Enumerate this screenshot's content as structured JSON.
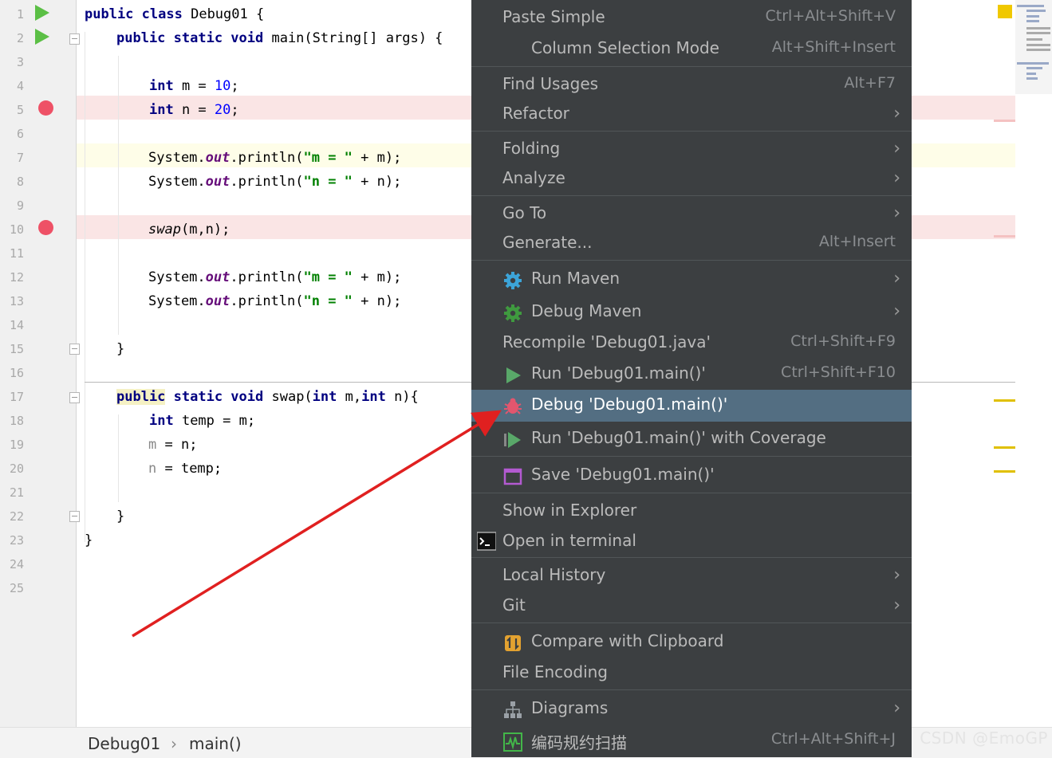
{
  "editor": {
    "line_numbers": [
      "1",
      "2",
      "3",
      "4",
      "5",
      "6",
      "7",
      "8",
      "9",
      "10",
      "11",
      "12",
      "13",
      "14",
      "15",
      "16",
      "17",
      "18",
      "19",
      "20",
      "21",
      "22",
      "23",
      "24",
      "25"
    ],
    "code": {
      "l1_public": "public",
      "l1_class": "class",
      "l1_rest": " Debug01 {",
      "l2_kw": "public static void",
      "l2_rest": " main(String[] args) {",
      "l4_kw": "int",
      "l4_rest": " m = ",
      "l4_num": "10",
      "l4_end": ";",
      "l5_kw": "int",
      "l5_rest": " n = ",
      "l5_num": "20",
      "l5_end": ";",
      "l7_a": "System.",
      "l7_out": "out",
      "l7_b": ".println(",
      "l7_str": "\"m = \"",
      "l7_c": " + m);",
      "l8_a": "System.",
      "l8_out": "out",
      "l8_b": ".println(",
      "l8_str": "\"n = \"",
      "l8_c": " + n);",
      "l10_swap": "swap",
      "l10_rest": "(m,n);",
      "l12_a": "System.",
      "l12_out": "out",
      "l12_b": ".println(",
      "l12_str": "\"m = \"",
      "l12_c": " + m);",
      "l13_a": "System.",
      "l13_out": "out",
      "l13_b": ".println(",
      "l13_str": "\"n = \"",
      "l13_c": " + n);",
      "l15": "}",
      "l17_public": "public",
      "l17_kw": " static void",
      "l17_a": " swap(",
      "l17_int1": "int",
      "l17_b": " m,",
      "l17_int2": "int",
      "l17_c": " n){",
      "l18_kw": "int",
      "l18_rest": " temp = m;",
      "l19_pv": "m",
      "l19_rest": " = n;",
      "l20_pv": "n",
      "l20_rest": " = temp;",
      "l22": "}",
      "l23": "}"
    }
  },
  "breadcrumb": {
    "file": "Debug01",
    "sep": "›",
    "method": "main()"
  },
  "context_menu": {
    "items": [
      {
        "label": "Paste Simple",
        "shortcut": "Ctrl+Alt+Shift+V"
      },
      {
        "label": "Column Selection Mode",
        "shortcut": "Alt+Shift+Insert"
      },
      {
        "label": "Find Usages",
        "shortcut": "Alt+F7"
      },
      {
        "label": "Refactor",
        "shortcut": ""
      },
      {
        "label": "Folding",
        "shortcut": ""
      },
      {
        "label": "Analyze",
        "shortcut": ""
      },
      {
        "label": "Go To",
        "shortcut": ""
      },
      {
        "label": "Generate...",
        "shortcut": "Alt+Insert"
      },
      {
        "label": "Run Maven",
        "shortcut": ""
      },
      {
        "label": "Debug Maven",
        "shortcut": ""
      },
      {
        "label": "Recompile 'Debug01.java'",
        "shortcut": "Ctrl+Shift+F9"
      },
      {
        "label": "Run 'Debug01.main()'",
        "shortcut": "Ctrl+Shift+F10"
      },
      {
        "label": "Debug 'Debug01.main()'",
        "shortcut": ""
      },
      {
        "label": "Run 'Debug01.main()' with Coverage",
        "shortcut": ""
      },
      {
        "label": "Save 'Debug01.main()'",
        "shortcut": ""
      },
      {
        "label": "Show in Explorer",
        "shortcut": ""
      },
      {
        "label": "Open in terminal",
        "shortcut": ""
      },
      {
        "label": "Local History",
        "shortcut": ""
      },
      {
        "label": "Git",
        "shortcut": ""
      },
      {
        "label": "Compare with Clipboard",
        "shortcut": ""
      },
      {
        "label": "File Encoding",
        "shortcut": ""
      },
      {
        "label": "Diagrams",
        "shortcut": ""
      },
      {
        "label": "编码规约扫描",
        "shortcut": "Ctrl+Alt+Shift+J"
      }
    ],
    "submenu_arrow": "›",
    "selected_index": 12
  },
  "icons": {
    "run": "run-icon",
    "debug": "debug-bug-icon",
    "maven": "gear-icon",
    "terminal": "terminal-icon",
    "compare": "compare-icon",
    "diagrams": "diagram-icon",
    "scan": "code-scan-icon",
    "breakpoint": "breakpoint-icon"
  },
  "colors": {
    "menu_bg": "#3c3f41",
    "menu_selected": "#536e82",
    "breakpoint": "#ee5166",
    "run": "#5bbf45",
    "annotation_arrow": "#e02020"
  },
  "watermark": "CSDN @EmoGP"
}
